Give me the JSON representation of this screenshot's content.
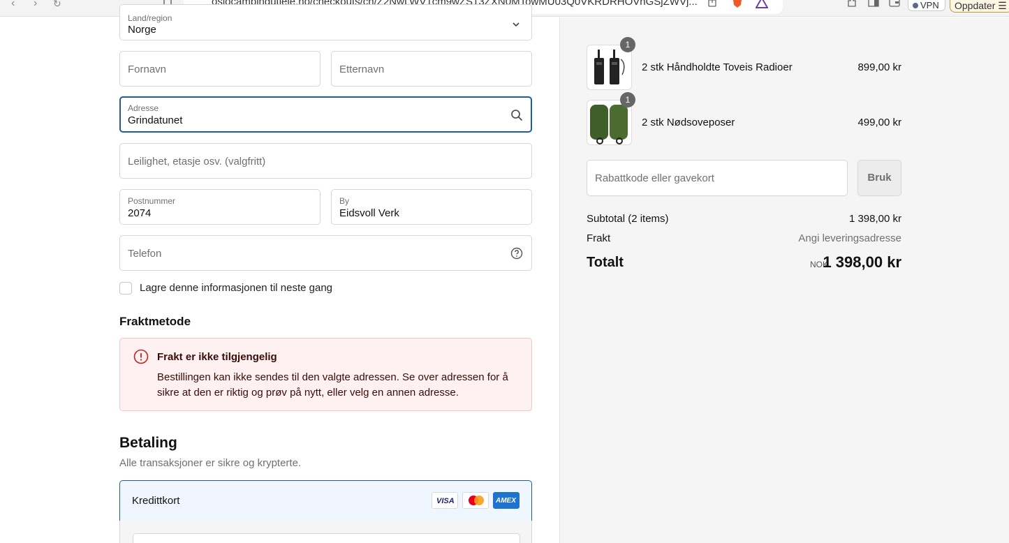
{
  "browser": {
    "url": "oslocampingutleie.no/checkouts/cn/Z2NwLWV1cm9wZS13ZXN0MTowMU03Q0VKRDRHOVhGSjZWVj...",
    "vpn_label": "VPN",
    "update_label": "Oppdater"
  },
  "form": {
    "country": {
      "label": "Land/region",
      "value": "Norge"
    },
    "first_name": {
      "placeholder": "Fornavn"
    },
    "last_name": {
      "placeholder": "Etternavn"
    },
    "address": {
      "label": "Adresse",
      "value": "Grindatunet"
    },
    "apartment": {
      "placeholder": "Leilighet, etasje osv. (valgfritt)"
    },
    "postal_code": {
      "label": "Postnummer",
      "value": "2074"
    },
    "city": {
      "label": "By",
      "value": "Eidsvoll Verk"
    },
    "phone": {
      "placeholder": "Telefon"
    },
    "save_info_label": "Lagre denne informasjonen til neste gang"
  },
  "shipping": {
    "title": "Fraktmetode",
    "alert_title": "Frakt er ikke tilgjengelig",
    "alert_text": "Bestillingen kan ikke sendes til den valgte adressen. Se over adressen for å sikre at den er riktig og prøv på nytt, eller velg en annen adresse."
  },
  "payment": {
    "title": "Betaling",
    "subtitle": "Alle transaksjoner er sikre og krypterte.",
    "method_label": "Kredittkort",
    "cards": [
      "VISA",
      "MASTERCARD",
      "AMEX"
    ]
  },
  "order": {
    "items": [
      {
        "quantity": "1",
        "name": "2 stk Håndholdte Toveis Radioer",
        "price": "899,00 kr"
      },
      {
        "quantity": "1",
        "name": "2 stk Nødsoveposer",
        "price": "499,00 kr"
      }
    ],
    "discount_placeholder": "Rabattkode eller gavekort",
    "apply_label": "Bruk",
    "subtotal_label": "Subtotal (2 items)",
    "subtotal_value": "1 398,00 kr",
    "shipping_label": "Frakt",
    "shipping_value": "Angi leveringsadresse",
    "total_label": "Totalt",
    "total_currency": "NOK",
    "total_value": "1 398,00 kr"
  },
  "colors": {
    "focus_border": "#1f5c8f",
    "alert_bg": "#fff1f1",
    "alert_icon": "#c91f1f"
  }
}
